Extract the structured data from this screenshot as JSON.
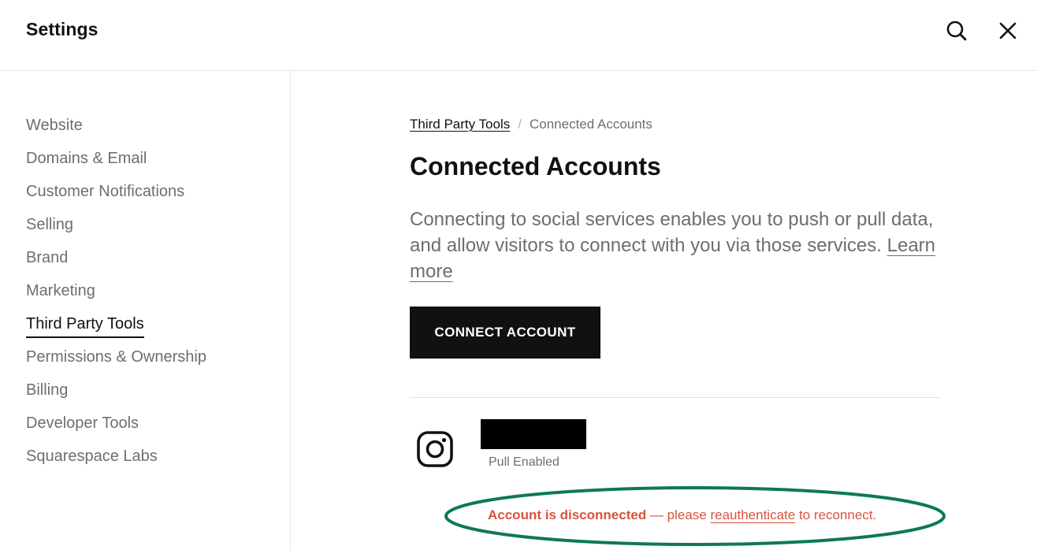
{
  "header": {
    "title": "Settings",
    "search_icon": "search-icon",
    "close_icon": "close-icon"
  },
  "sidebar": {
    "items": [
      {
        "label": "Website"
      },
      {
        "label": "Domains & Email"
      },
      {
        "label": "Customer Notifications"
      },
      {
        "label": "Selling"
      },
      {
        "label": "Brand"
      },
      {
        "label": "Marketing"
      },
      {
        "label": "Third Party Tools",
        "active": true
      },
      {
        "label": "Permissions & Ownership"
      },
      {
        "label": "Billing"
      },
      {
        "label": "Developer Tools"
      },
      {
        "label": "Squarespace Labs"
      }
    ]
  },
  "main": {
    "breadcrumb": {
      "parent": "Third Party Tools",
      "separator": "/",
      "current": "Connected Accounts"
    },
    "title": "Connected Accounts",
    "description": "Connecting to social services enables you to push or pull data, and allow visitors to connect with you via those services.",
    "learn_more": "Learn more",
    "connect_button": "CONNECT ACCOUNT",
    "account": {
      "service_icon": "instagram-icon",
      "status": "Pull Enabled",
      "warning": {
        "bold": "Account is disconnected",
        "middle": " — please ",
        "link": "reauthenticate",
        "end": " to reconnect."
      }
    }
  },
  "colors": {
    "text_primary": "#111111",
    "text_secondary": "#6e6e6e",
    "button_bg": "#111111",
    "warning": "#d9533c",
    "annotation_ellipse": "#0d7a4f"
  }
}
